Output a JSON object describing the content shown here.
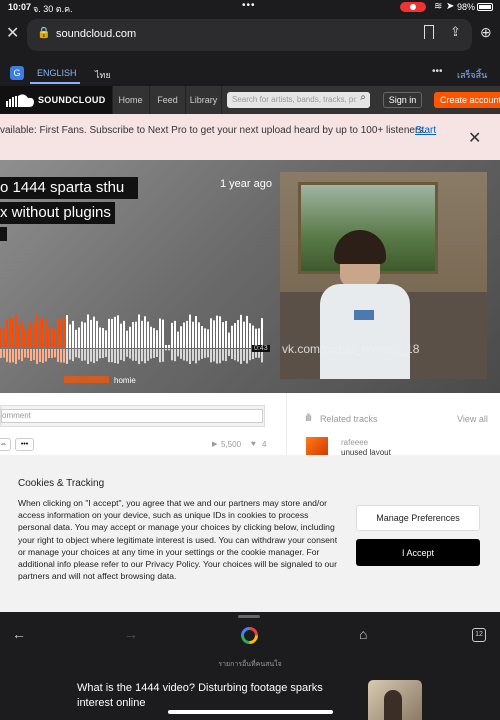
{
  "status": {
    "time": "10:07",
    "date": "จ. 30 ต.ค.",
    "dots": "•••",
    "battery": "98%"
  },
  "browser": {
    "url": "soundcloud.com"
  },
  "translate": {
    "lang_en": "ENGLISH",
    "lang_th": "ไทย",
    "more": "•••",
    "done": "เสร็จสิ้น"
  },
  "sc_header": {
    "logo": "SOUNDCLOUD",
    "nav": [
      "Home",
      "Feed",
      "Library"
    ],
    "search_placeholder": "Search for artists, bands, tracks, podcasts",
    "signin": "Sign in",
    "create": "Create account"
  },
  "banner": {
    "text": "vailable: First Fans. Subscribe to Next Pro to get your next upload heard by up to 100+ listeners.",
    "link": "Start"
  },
  "track": {
    "title_line1": "o 1444 sparta sthu",
    "title_line2": "x without plugins",
    "posted": "1 year ago",
    "duration": "0:43",
    "comment_user": "homie",
    "artwork_watermark": "vk.com/pizhie_novosti_18",
    "played_fraction": 0.25
  },
  "comment": {
    "placeholder": "omment"
  },
  "stats": {
    "plays": "5,500",
    "likes": "4",
    "more": "•••"
  },
  "related": {
    "title": "Related tracks",
    "view_all": "View all",
    "artist": "rafeeee",
    "track": "unused layout"
  },
  "cookie": {
    "title": "Cookies & Tracking",
    "body": "When clicking on \"I accept\", you agree that we and our partners may store and/or access information on your device, such as unique IDs in cookies to process personal data. You may accept or manage your choices by clicking below, including your right to object where legitimate interest is used. You can withdraw your consent or manage your choices at any time in your settings or the cookie manager. For additional info please refer to our Privacy Policy. Your choices will be signaled to our partners and will not affect browsing data.",
    "manage": "Manage Preferences",
    "accept": "I Accept"
  },
  "toolbar": {
    "tabs_count": "12"
  },
  "suggest": {
    "header": "รายการอื่นที่คนสนใจ",
    "headline": "What is the 1444 video? Disturbing footage sparks interest online"
  },
  "colors": {
    "accent": "#ff5500",
    "banner_bg": "#f6e4e5",
    "link": "#0063d1"
  }
}
